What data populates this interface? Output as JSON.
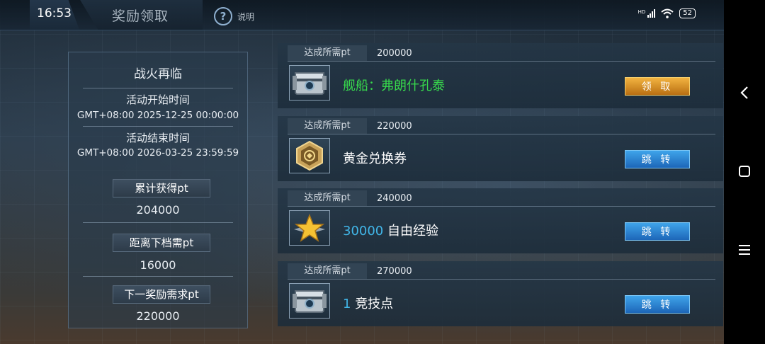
{
  "status_bar": {
    "time": "16:53",
    "network": "HD",
    "battery": "52"
  },
  "header": {
    "title": "奖励领取",
    "help_label": "说明",
    "help_glyph": "?"
  },
  "event": {
    "name": "战火再临",
    "start_label": "活动开始时间",
    "start_time": "GMT+08:00 2025-12-25 00:00:00",
    "end_label": "活动结束时间",
    "end_time": "GMT+08:00 2026-03-25 23:59:59",
    "stats": [
      {
        "label": "累计获得pt",
        "value": "204000"
      },
      {
        "label": "距离下档需pt",
        "value": "16000"
      },
      {
        "label": "下一奖励需求pt",
        "value": "220000"
      }
    ]
  },
  "rewards": [
    {
      "req_label": "达成所需pt",
      "req_value": "200000",
      "icon": "treasure-chest-icon",
      "name": "舰船：弗朗什孔泰",
      "button": "领 取",
      "button_type": "claim"
    },
    {
      "req_label": "达成所需pt",
      "req_value": "220000",
      "icon": "gold-voucher-icon",
      "name": "黄金兑换券",
      "button": "跳 转",
      "button_type": "jump"
    },
    {
      "req_label": "达成所需pt",
      "req_value": "240000",
      "icon": "gold-star-icon",
      "qty": "30000",
      "name": "自由经验",
      "button": "跳 转",
      "button_type": "jump"
    },
    {
      "req_label": "达成所需pt",
      "req_value": "270000",
      "icon": "treasure-chest-icon",
      "qty": "1",
      "name": "竞技点",
      "button": "跳 转",
      "button_type": "jump"
    }
  ],
  "colors": {
    "highlight_green": "#37d84c",
    "quantity_blue": "#41b6e8",
    "claim_gold": "#e0a030",
    "jump_blue": "#2b86d2"
  }
}
